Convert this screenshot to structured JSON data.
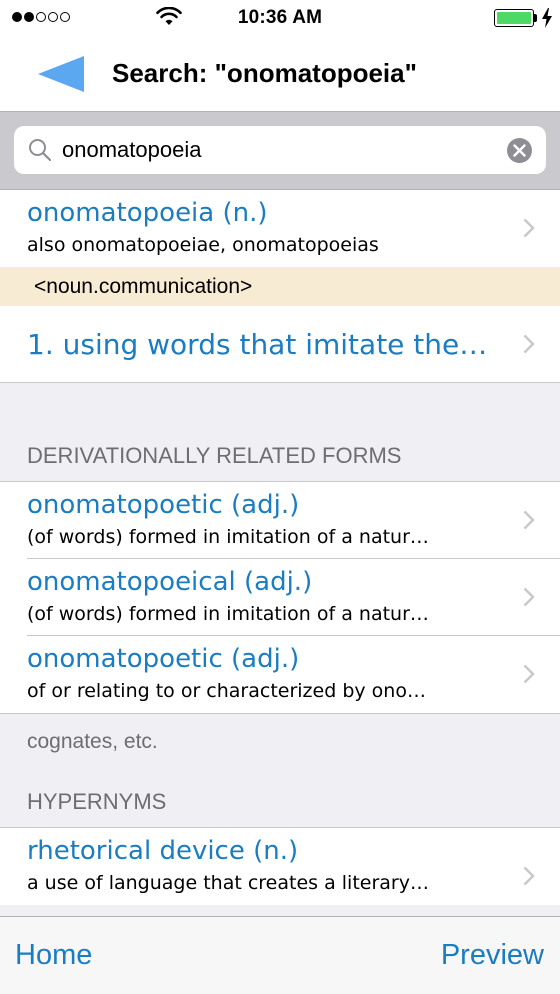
{
  "status_bar": {
    "time": "10:36 AM",
    "signal_bars_filled": 2,
    "signal_bars_total": 5,
    "battery_level": 1.0,
    "battery_color": "#4cd964",
    "icons": [
      "signal-dots-icon",
      "wifi-icon",
      "battery-icon",
      "charging-bolt-icon"
    ]
  },
  "nav": {
    "back_icon": "back-arrow-icon",
    "title": "Search: \"onomatopoeia\""
  },
  "search": {
    "value": "onomatopoeia",
    "search_icon": "magnifier-icon",
    "clear_icon": "clear-x-icon"
  },
  "entry": {
    "title": "onomatopoeia (n.)",
    "subtitle": "also onomatopoeiae, onomatopoeias",
    "category": "<noun.communication>",
    "definition": "1. using words that imitate the…"
  },
  "derivational": {
    "header": "DERIVATIONALLY RELATED FORMS",
    "items": [
      {
        "title": "onomatopoetic (adj.)",
        "subtitle": "(of words) formed in imitation of a natur…"
      },
      {
        "title": "onomatopoeical (adj.)",
        "subtitle": "(of words) formed in imitation of a natur…"
      },
      {
        "title": "onomatopoetic (adj.)",
        "subtitle": "of or relating to or characterized by ono…"
      }
    ],
    "footer": "cognates, etc."
  },
  "hypernyms": {
    "header": "HYPERNYMS",
    "items": [
      {
        "title": "rhetorical device (n.)",
        "subtitle": "a use of language that creates a literary…"
      }
    ]
  },
  "tab_bar": {
    "home_label": "Home",
    "preview_label": "Preview"
  },
  "colors": {
    "accent": "#1a7dc2",
    "back_arrow": "#5ba8f0",
    "category_band": "#f7ecd3",
    "grouped_background": "#efeff4"
  }
}
